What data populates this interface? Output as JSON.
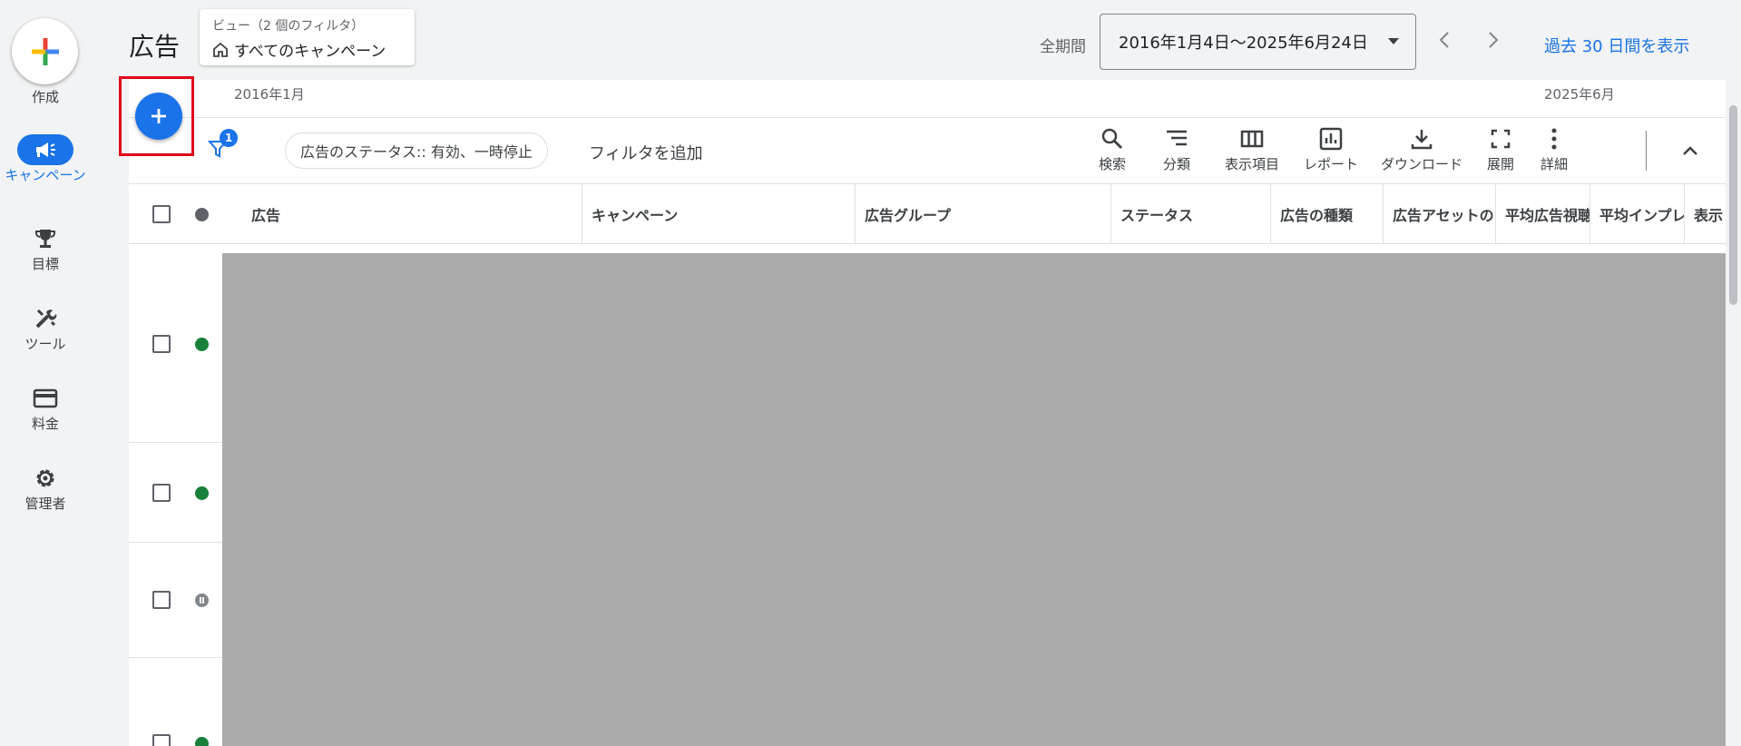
{
  "rail": {
    "create_label": "作成",
    "items": [
      {
        "label": "キャンペーン",
        "icon": "campaign-megaphone-icon",
        "active": true
      },
      {
        "label": "目標",
        "icon": "trophy-icon",
        "active": false
      },
      {
        "label": "ツール",
        "icon": "tools-icon",
        "active": false
      },
      {
        "label": "料金",
        "icon": "billing-card-icon",
        "active": false
      },
      {
        "label": "管理者",
        "icon": "gear-icon",
        "active": false
      }
    ]
  },
  "header": {
    "title": "広告",
    "view_sub": "ビュー（2 個のフィルタ）",
    "view_main": "すべてのキャンペーン",
    "period_label": "全期間",
    "date_range": "2016年1月4日〜2025年6月24日",
    "last30": "過去 30 日間を表示"
  },
  "timeline": {
    "start": "2016年1月",
    "end": "2025年6月"
  },
  "toolbar": {
    "filter_count": "1",
    "filter_chip": "広告のステータス:: 有効、一時停止",
    "add_filter": "フィルタを追加",
    "tools": [
      {
        "label": "検索",
        "icon": "search-icon"
      },
      {
        "label": "分類",
        "icon": "segment-icon"
      },
      {
        "label": "表示項目",
        "icon": "columns-icon"
      },
      {
        "label": "レポート",
        "icon": "report-icon"
      },
      {
        "label": "ダウンロード",
        "icon": "download-icon"
      },
      {
        "label": "展開",
        "icon": "fullscreen-icon"
      },
      {
        "label": "詳細",
        "icon": "more-vert-icon"
      }
    ]
  },
  "table": {
    "columns": [
      "広告",
      "キャンペーン",
      "広告グループ",
      "ステータス",
      "広告の種類",
      "広告アセットの",
      "平均広告視聴",
      "平均インプレ",
      "表示"
    ],
    "rows": [
      {
        "status": "enabled"
      },
      {
        "status": "enabled"
      },
      {
        "status": "paused"
      },
      {
        "status": "enabled"
      }
    ]
  },
  "colors": {
    "accent": "#1a73e8",
    "enabled": "#188038",
    "paused": "#80868b",
    "highlight": "#e0001a"
  }
}
